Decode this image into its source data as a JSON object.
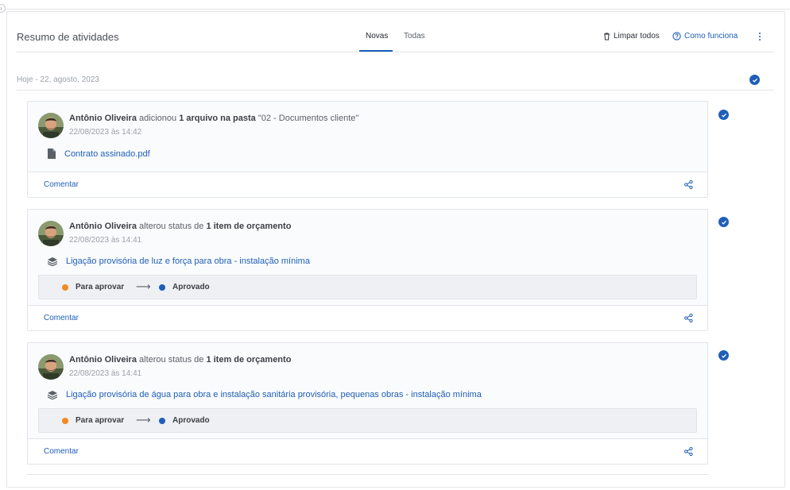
{
  "header": {
    "title": "Resumo de atividades",
    "tabs": [
      {
        "label": "Novas",
        "active": true
      },
      {
        "label": "Todas",
        "active": false
      }
    ],
    "clear_all_label": "Limpar todos",
    "how_it_works_label": "Como funciona"
  },
  "date_group": {
    "label": "Hoje - 22, agosto, 2023"
  },
  "activities": [
    {
      "actor": "Antônio Oliveira",
      "verb": "adicionou",
      "object": "1 arquivo na pasta",
      "target": "\"02 - Documentos cliente\"",
      "timestamp": "22/08/2023 às 14:42",
      "item_icon": "file-icon",
      "item_label": "Contrato assinado.pdf",
      "comment_label": "Comentar"
    },
    {
      "actor": "Antônio Oliveira",
      "verb": "alterou status de",
      "object": "1 item de orçamento",
      "target": "",
      "timestamp": "22/08/2023 às 14:41",
      "item_icon": "layers-icon",
      "item_label": "Ligação provisória de luz e força para obra - instalação mínima",
      "status_from": "Para aprovar",
      "status_to": "Aprovado",
      "comment_label": "Comentar"
    },
    {
      "actor": "Antônio Oliveira",
      "verb": "alterou status de",
      "object": "1 item de orçamento",
      "target": "",
      "timestamp": "22/08/2023 às 14:41",
      "item_icon": "layers-icon",
      "item_label": "Ligação provisória de água para obra e instalação sanitária provisória, pequenas obras - instalação mínima",
      "status_from": "Para aprovar",
      "status_to": "Aprovado",
      "comment_label": "Comentar"
    }
  ],
  "colors": {
    "accent": "#1f5fb8",
    "status_pending": "#f08a24",
    "status_approved": "#1f5fb8"
  }
}
